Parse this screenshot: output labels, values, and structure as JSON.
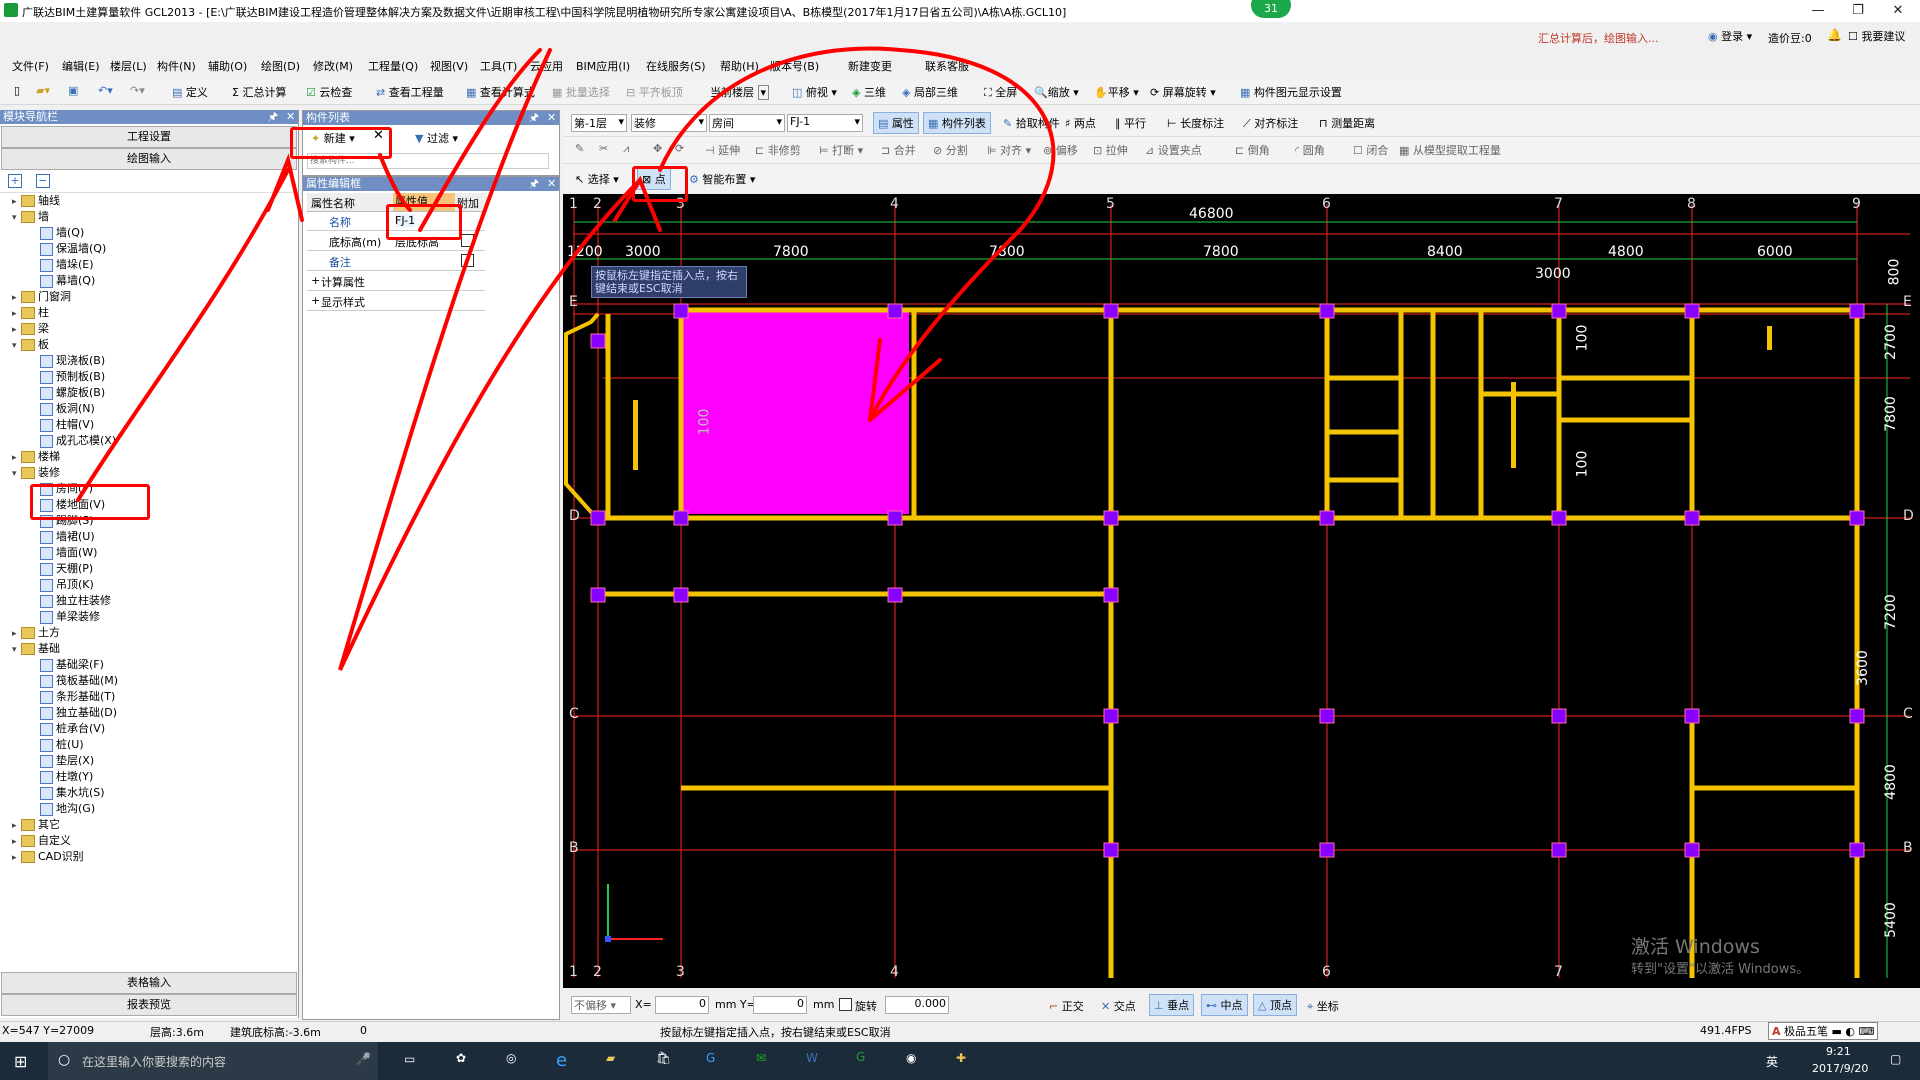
{
  "title_bar": {
    "title": "广联达BIM土建算量软件 GCL2013 - [E:\\广联达BIM建设工程造价管理整体解决方案及数据文件\\近期审核工程\\中国科学院昆明植物研究所专家公寓建设项目\\A、B栋模型(2017年1月17日省五公司)\\A栋\\A栋.GCL10]",
    "badge": "31"
  },
  "top_right": {
    "notice": "汇总计算后，绘图输入...",
    "login": "登录",
    "price_bean": "造价豆:0",
    "suggest": "我要建议"
  },
  "menu": [
    "文件(F)",
    "编辑(E)",
    "楼层(L)",
    "构件(N)",
    "辅助(O)",
    "绘图(D)",
    "修改(M)",
    "工程量(Q)",
    "视图(V)",
    "工具(T)",
    "云应用",
    "BIM应用(I)",
    "在线服务(S)",
    "帮助(H)",
    "版本号(B)",
    "新建变更",
    "联系客服"
  ],
  "toolbar1": [
    "定义",
    "汇总计算",
    "云检查",
    "查看工程量",
    "查看计算式",
    "批量选择",
    "平齐板顶",
    "当前楼层",
    "俯视",
    "三维",
    "局部三维",
    "全屏",
    "缩放",
    "平移",
    "屏幕旋转",
    "构件图元显示设置"
  ],
  "toolbar2": {
    "floor": "第-1层",
    "category": "装修",
    "type": "房间",
    "component": "FJ-1",
    "buttons": [
      "属性",
      "构件列表",
      "拾取构件",
      "两点",
      "平行",
      "长度标注",
      "对齐标注",
      "测量距离"
    ]
  },
  "toolbar3": [
    "延伸",
    "非修剪",
    "打断",
    "合并",
    "分割",
    "对齐",
    "偏移",
    "拉伸",
    "设置夹点",
    "倒角",
    "圆角",
    "闭合",
    "从模型提取工程量"
  ],
  "toolbar4": {
    "select": "选择",
    "point": "点",
    "smart": "智能布置"
  },
  "nav": {
    "header": "模块导航栏",
    "btn_project": "工程设置",
    "btn_draw": "绘图输入",
    "btn_table": "表格输入",
    "btn_report": "报表预览",
    "tree": [
      {
        "label": "轴线",
        "level": 0,
        "exp": "+"
      },
      {
        "label": "墙",
        "level": 0,
        "exp": "-"
      },
      {
        "label": "墙(Q)",
        "level": 1
      },
      {
        "label": "保温墙(Q)",
        "level": 1
      },
      {
        "label": "墙垛(E)",
        "level": 1
      },
      {
        "label": "幕墙(Q)",
        "level": 1
      },
      {
        "label": "门窗洞",
        "level": 0,
        "exp": "+"
      },
      {
        "label": "柱",
        "level": 0,
        "exp": "+"
      },
      {
        "label": "梁",
        "level": 0,
        "exp": "+"
      },
      {
        "label": "板",
        "level": 0,
        "exp": "-"
      },
      {
        "label": "现浇板(B)",
        "level": 1
      },
      {
        "label": "预制板(B)",
        "level": 1
      },
      {
        "label": "螺旋板(B)",
        "level": 1
      },
      {
        "label": "板洞(N)",
        "level": 1
      },
      {
        "label": "柱帽(V)",
        "level": 1
      },
      {
        "label": "成孔芯模(X)",
        "level": 1
      },
      {
        "label": "楼梯",
        "level": 0,
        "exp": "+"
      },
      {
        "label": "装修",
        "level": 0,
        "exp": "-"
      },
      {
        "label": "房间(F)",
        "level": 1
      },
      {
        "label": "楼地面(V)",
        "level": 1
      },
      {
        "label": "踢脚(S)",
        "level": 1
      },
      {
        "label": "墙裙(U)",
        "level": 1
      },
      {
        "label": "墙面(W)",
        "level": 1
      },
      {
        "label": "天棚(P)",
        "level": 1
      },
      {
        "label": "吊顶(K)",
        "level": 1
      },
      {
        "label": "独立柱装修",
        "level": 1
      },
      {
        "label": "单梁装修",
        "level": 1
      },
      {
        "label": "土方",
        "level": 0,
        "exp": "+"
      },
      {
        "label": "基础",
        "level": 0,
        "exp": "-"
      },
      {
        "label": "基础梁(F)",
        "level": 1
      },
      {
        "label": "筏板基础(M)",
        "level": 1
      },
      {
        "label": "条形基础(T)",
        "level": 1
      },
      {
        "label": "独立基础(D)",
        "level": 1
      },
      {
        "label": "桩承台(V)",
        "level": 1
      },
      {
        "label": "桩(U)",
        "level": 1
      },
      {
        "label": "垫层(X)",
        "level": 1
      },
      {
        "label": "柱墩(Y)",
        "level": 1
      },
      {
        "label": "集水坑(S)",
        "level": 1
      },
      {
        "label": "地沟(G)",
        "level": 1
      },
      {
        "label": "其它",
        "level": 0,
        "exp": "+"
      },
      {
        "label": "自定义",
        "level": 0,
        "exp": "+"
      },
      {
        "label": "CAD识别",
        "level": 0,
        "exp": "+"
      }
    ]
  },
  "component_list": {
    "header": "构件列表",
    "new_btn": "新建",
    "filter_btn": "过滤",
    "search_hint": "搜索构件..."
  },
  "property": {
    "header": "属性编辑框",
    "col_name": "属性名称",
    "col_value": "属性值",
    "col_extra": "附加",
    "rows": [
      {
        "k": "名称",
        "v": "FJ-1"
      },
      {
        "k": "底标高(m)",
        "v": "层底标高"
      },
      {
        "k": "备注",
        "v": ""
      },
      {
        "k": "计算属性",
        "v": ""
      },
      {
        "k": "显示样式",
        "v": ""
      }
    ]
  },
  "cad": {
    "tooltip": "按鼠标左键指定插入点，按右键结束或ESC取消",
    "top_axes": [
      "1",
      "2",
      "3",
      "4",
      "5",
      "6",
      "7",
      "8",
      "9"
    ],
    "side_axes": [
      "E",
      "D",
      "C",
      "B"
    ],
    "total_dim": "46800",
    "dims_top": [
      "1200",
      "3000",
      "7800",
      "7800",
      "7800",
      "8400",
      "4800",
      "6000"
    ],
    "dim_3000": "3000",
    "right_dims": [
      "2700",
      "800",
      "7800",
      "7200",
      "3600",
      "4800",
      "5400"
    ],
    "small_labels": [
      "100",
      "100",
      "100"
    ],
    "watermark1": "激活 Windows",
    "watermark2": "转到\"设置\"以激活 Windows。"
  },
  "snapbar": {
    "no_offset": "不偏移",
    "x_label": "X=",
    "x_val": "0",
    "y_label": "mm Y=",
    "y_val": "0",
    "mm": "mm",
    "rotate": "旋转",
    "rot_val": "0.000",
    "buttons": [
      "正交",
      "交点",
      "垂点",
      "中点",
      "顶点",
      "坐标"
    ]
  },
  "status": {
    "coords": "X=547 Y=27009",
    "floor_h": "层高:3.6m",
    "base_elev": "建筑底标高:-3.6m",
    "zero": "0",
    "hint": "按鼠标左键指定插入点，按右键结束或ESC取消",
    "fps": "491.4FPS",
    "ime": "极品五笔"
  },
  "taskbar": {
    "search": "在这里输入你要搜索的内容",
    "time": "9:21",
    "date": "2017/9/20",
    "lang": "英"
  }
}
